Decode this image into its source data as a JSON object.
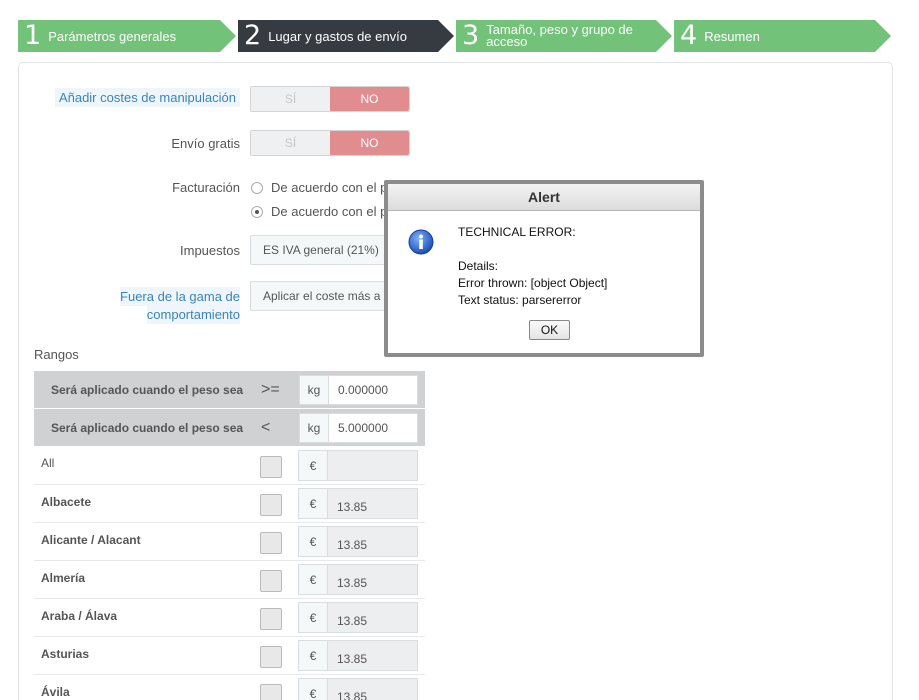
{
  "steps": [
    {
      "num": "1",
      "label": "Parámetros generales"
    },
    {
      "num": "2",
      "label": "Lugar y gastos de envío"
    },
    {
      "num": "3",
      "label": "Tamaño, peso y grupo de acceso"
    },
    {
      "num": "4",
      "label": "Resumen"
    }
  ],
  "form": {
    "handling_label": "Añadir costes de manipulación",
    "free_shipping_label": "Envío gratis",
    "yes": "SÍ",
    "no": "NO",
    "billing_label": "Facturación",
    "billing_option_1": "De acuerdo con el pr",
    "billing_option_2": "De acuerdo con el pe",
    "tax_label": "Impuestos",
    "tax_value": "ES IVA general (21%)",
    "out_of_range_label_1": "Fuera de la gama de",
    "out_of_range_label_2": "comportamiento",
    "out_of_range_value": "Aplicar el coste más a"
  },
  "ranges": {
    "title": "Rangos",
    "head": [
      {
        "text": "Será aplicado cuando el peso sea",
        "op": ">=",
        "unit": "kg",
        "value": "0.000000"
      },
      {
        "text": "Será aplicado cuando el peso sea",
        "op": "<",
        "unit": "kg",
        "value": "5.000000"
      }
    ],
    "currency": "€",
    "rows": [
      {
        "name": "All",
        "amount": ""
      },
      {
        "name": "Albacete",
        "amount": "13.85"
      },
      {
        "name": "Alicante / Alacant",
        "amount": "13.85"
      },
      {
        "name": "Almería",
        "amount": "13.85"
      },
      {
        "name": "Araba / Álava",
        "amount": "13.85"
      },
      {
        "name": "Asturias",
        "amount": "13.85"
      },
      {
        "name": "Ávila",
        "amount": "13.85"
      }
    ]
  },
  "alert": {
    "title": "Alert",
    "line1": "TECHNICAL ERROR:",
    "line2": "Details:",
    "line3": "Error thrown: [object Object]",
    "line4": "Text status: parsererror",
    "ok": "OK"
  },
  "colors": {
    "step_done": "#72c279",
    "step_active": "#363a41",
    "toggle_no": "#e18d90",
    "help_text": "#3a84b7"
  }
}
